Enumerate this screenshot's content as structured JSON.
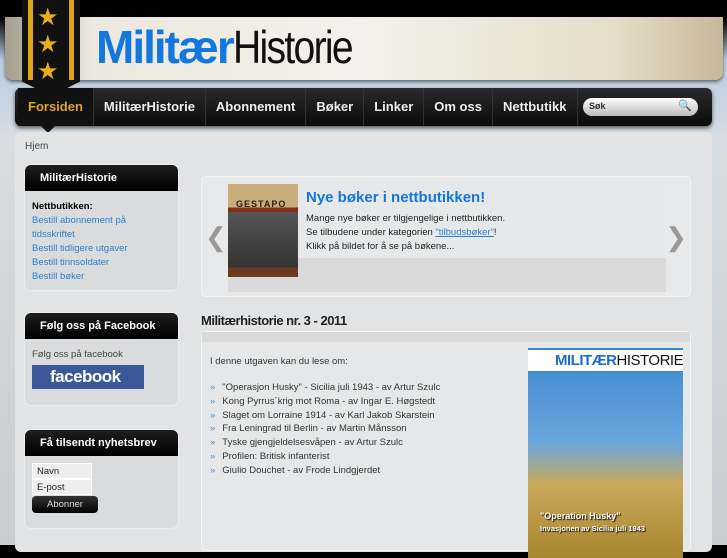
{
  "header": {
    "logo_part1": "Militær",
    "logo_part2": "Historie"
  },
  "nav": {
    "items": [
      "Forsiden",
      "MilitærHistorie",
      "Abonnement",
      "Bøker",
      "Linker",
      "Om oss",
      "Nettbutikk"
    ],
    "active": "Forsiden",
    "search_placeholder": "Søk"
  },
  "breadcrumb": "Hjem",
  "sidebar": {
    "box1": {
      "title": "MilitærHistorie",
      "subtitle": "Nettbutikken:",
      "links": [
        "Bestill abonnement på tidsskriftet",
        "Bestill tidligere utgaver",
        "Bestill tinnsoldater",
        "Bestill bøker"
      ]
    },
    "box2": {
      "title": "Følg oss på Facebook",
      "text": "Følg oss på facebook",
      "button": "facebook"
    },
    "box3": {
      "title": "Få tilsendt nyhetsbrev",
      "name_placeholder": "Navn",
      "email_placeholder": "E-post",
      "submit": "Abonner"
    }
  },
  "slider": {
    "book_title": "GESTAPO",
    "title": "Nye bøker i nettbutikken!",
    "line1": "Mange nye bøker er tilgjengelige i nettbutikken.",
    "line2_pre": "Se tilbudene under kategorien ",
    "line2_link": "\"tilbudsbøker\"",
    "line2_post": "!",
    "line3": "Klikk på bildet for å se på bøkene..."
  },
  "article": {
    "title": "Militærhistorie nr. 3 - 2011",
    "intro": "I denne utgaven kan du lese om:",
    "items": [
      "\"Operasjon Husky\" - Sicilia juli 1943 - av Artur Szulc",
      "Kong Pyrrus´krig mot Roma - av Ingar E. Høgstedt",
      "Slaget om Lorraine 1914 - av Karl Jakob Skarstein",
      "Fra Leningrad til Berlin - av Martin Månsson",
      "Tyske gjengjeldelsesvåpen - av Artur Szulc",
      "Profilen: Britisk infanterist",
      "Giulio Douchet - av Frode Lindgjerdet"
    ],
    "cover": {
      "mast1": "MILITÆR",
      "mast2": "HISTORIE",
      "caption": "\"Operation Husky\"",
      "subcaption": "Invasjonen av Sicilia juli 1943"
    }
  }
}
